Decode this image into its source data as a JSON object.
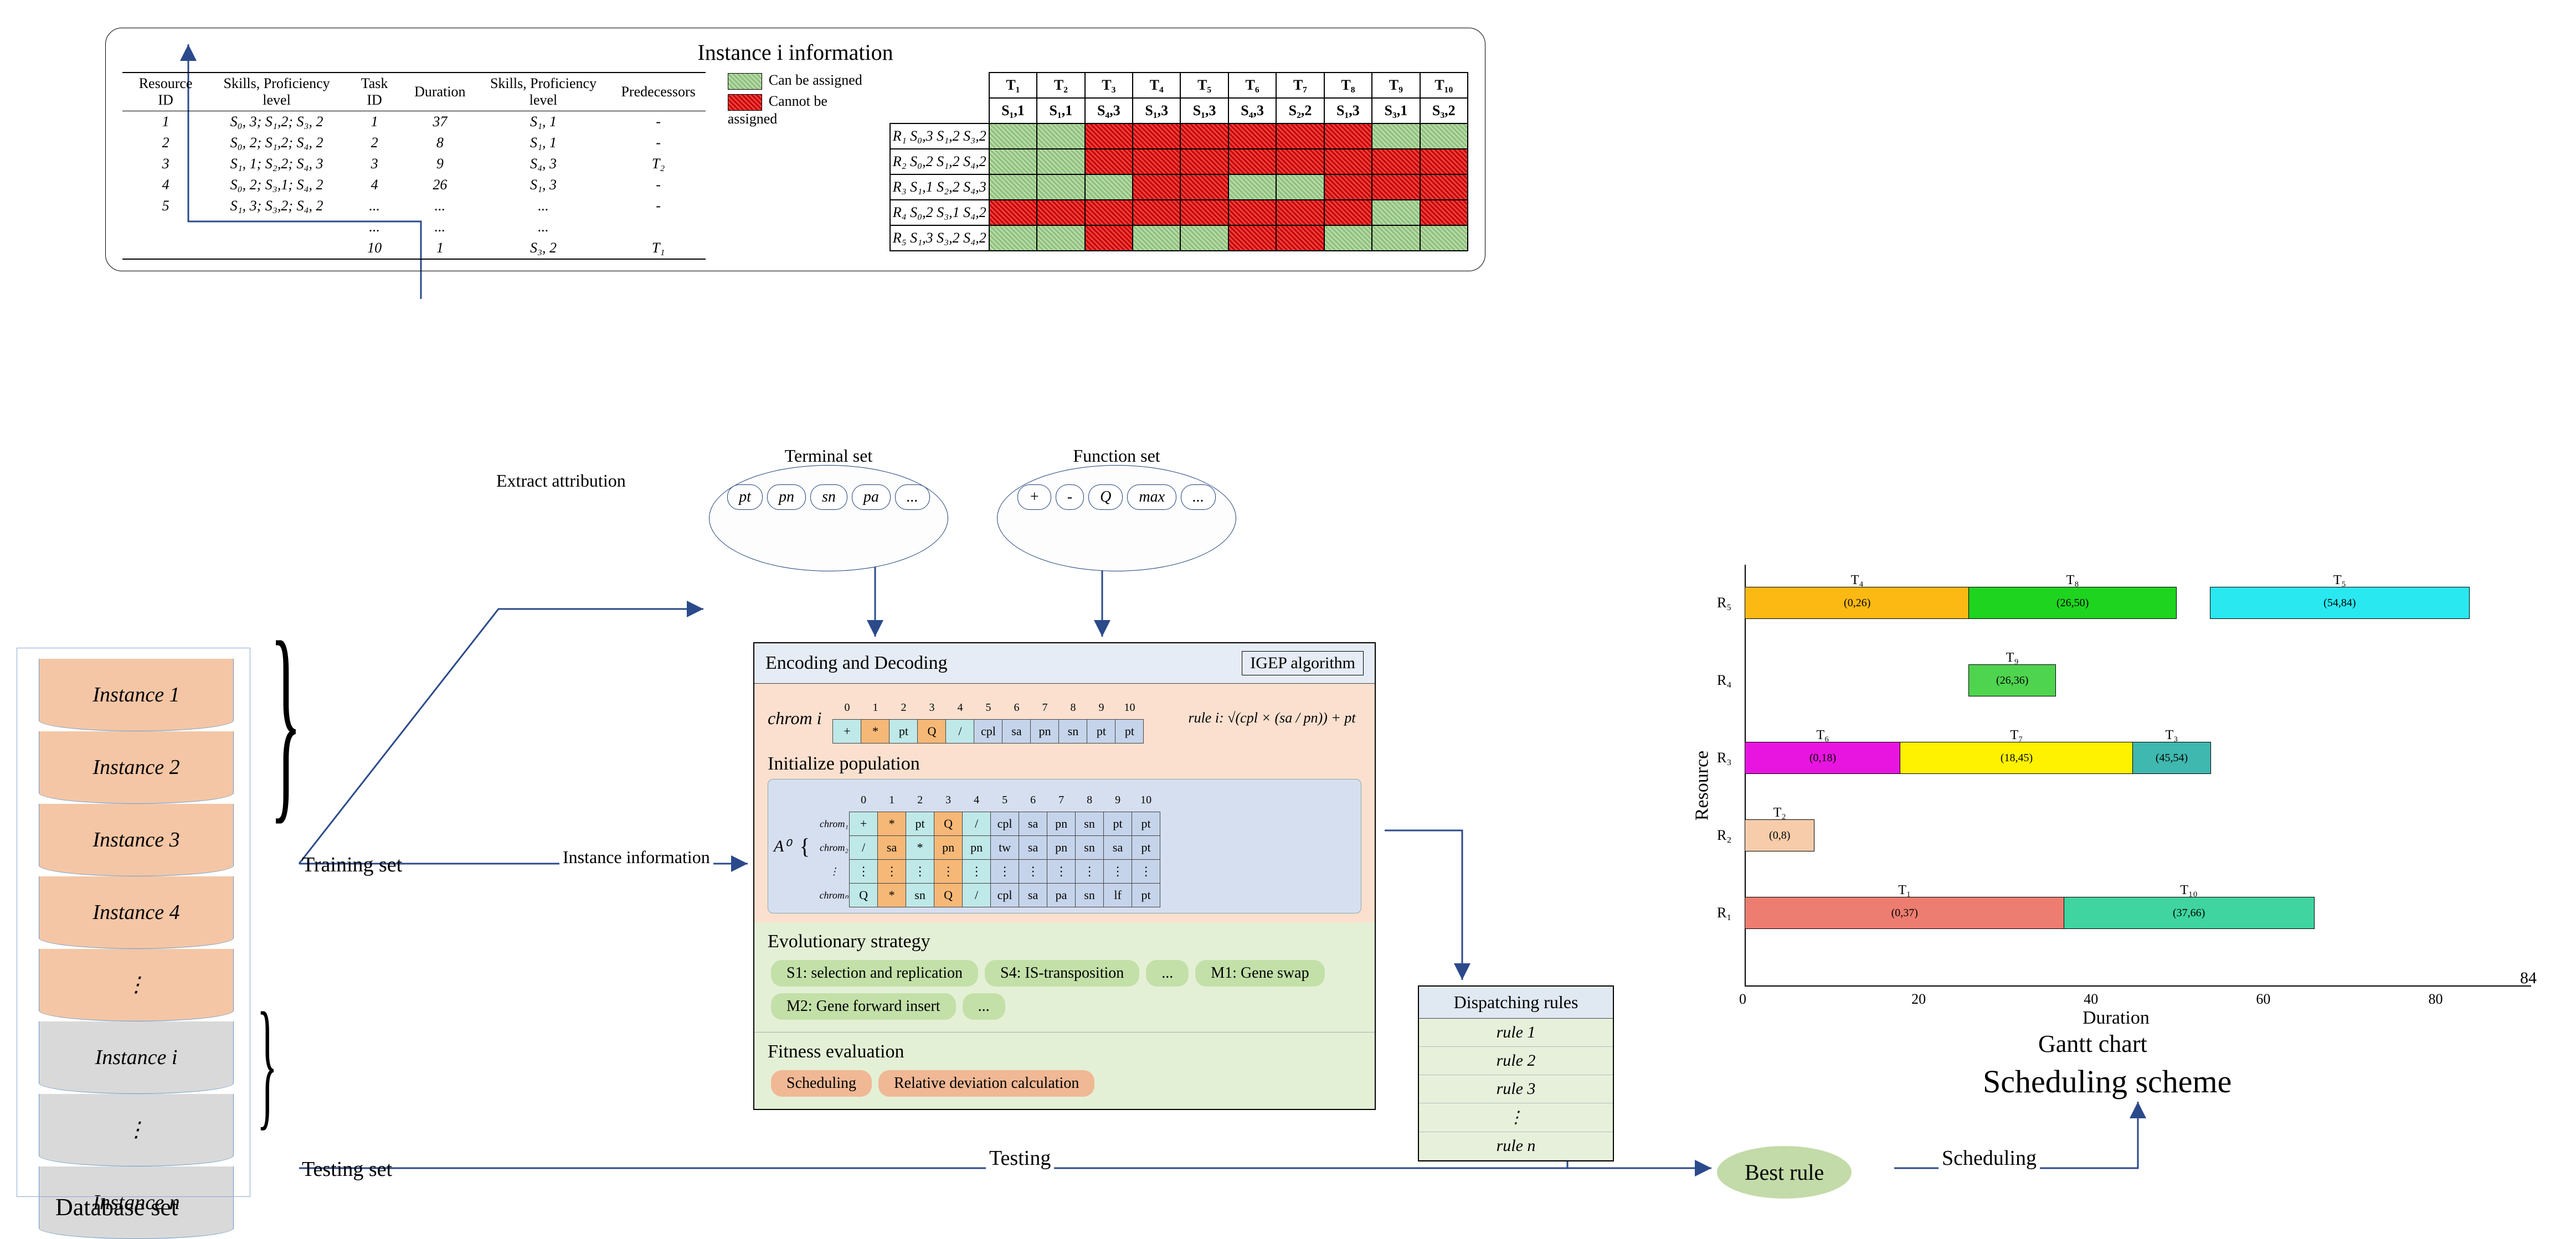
{
  "title": "Instance i information",
  "resource_table": {
    "headers": [
      "Resource ID",
      "Skills, Proficiency level",
      "Task ID",
      "Duration",
      "Skills, Proficiency level",
      "Predecessors"
    ],
    "rows": [
      [
        "1",
        "S₀, 3; S₁,2; S₃, 2",
        "1",
        "37",
        "S₁, 1",
        "-"
      ],
      [
        "2",
        "S₀, 2; S₁,2; S₄, 2",
        "2",
        "8",
        "S₁, 1",
        "-"
      ],
      [
        "3",
        "S₁, 1; S₂,2; S₄, 3",
        "3",
        "9",
        "S₄, 3",
        "T₂"
      ],
      [
        "4",
        "S₀, 2; S₃,1; S₄, 2",
        "4",
        "26",
        "S₁, 3",
        "-"
      ],
      [
        "5",
        "S₁, 3; S₃,2; S₄, 2",
        "...",
        "...",
        "...",
        "-"
      ],
      [
        "",
        "",
        "...",
        "...",
        "...",
        ""
      ],
      [
        "",
        "",
        "10",
        "1",
        "S₃, 2",
        "T₁"
      ]
    ]
  },
  "legend": {
    "can": "Can be assigned",
    "cannot": "Cannot be assigned"
  },
  "assign": {
    "tasks": [
      "T₁",
      "T₂",
      "T₃",
      "T₄",
      "T₅",
      "T₆",
      "T₇",
      "T₈",
      "T₉",
      "T₁₀"
    ],
    "skills": [
      "S₁,1",
      "S₁,1",
      "S₄,3",
      "S₁,3",
      "S₁,3",
      "S₄,3",
      "S₂,2",
      "S₁,3",
      "S₃,1",
      "S₃,2"
    ],
    "rows": [
      {
        "r": "R₁",
        "sk": "S₀,3 S₁,2 S₃,2",
        "cells": [
          "g",
          "g",
          "r",
          "r",
          "r",
          "r",
          "r",
          "r",
          "g",
          "g"
        ]
      },
      {
        "r": "R₂",
        "sk": "S₀,2 S₁,2 S₄,2",
        "cells": [
          "g",
          "g",
          "r",
          "r",
          "r",
          "r",
          "r",
          "r",
          "r",
          "r"
        ]
      },
      {
        "r": "R₃",
        "sk": "S₁,1 S₂,2 S₄,3",
        "cells": [
          "g",
          "g",
          "g",
          "r",
          "r",
          "g",
          "g",
          "r",
          "r",
          "r"
        ]
      },
      {
        "r": "R₄",
        "sk": "S₀,2 S₃,1 S₄,2",
        "cells": [
          "r",
          "r",
          "r",
          "r",
          "r",
          "r",
          "r",
          "r",
          "g",
          "r"
        ]
      },
      {
        "r": "R₅",
        "sk": "S₁,3 S₃,2 S₄,2",
        "cells": [
          "g",
          "g",
          "r",
          "g",
          "g",
          "r",
          "r",
          "g",
          "g",
          "g"
        ]
      }
    ]
  },
  "database": {
    "label": "Database set",
    "training": [
      "Instance 1",
      "Instance 2",
      "Instance 3",
      "Instance 4",
      "⋮"
    ],
    "testing": [
      "Instance i",
      "⋮",
      "Instance n"
    ]
  },
  "sets": {
    "train": "Training set",
    "test": "Testing set"
  },
  "terminal": {
    "title": "Terminal set",
    "items": [
      "pt",
      "pn",
      "sn",
      "pa",
      "..."
    ]
  },
  "function": {
    "title": "Function set",
    "items": [
      "+",
      "-",
      "Q",
      "max",
      "..."
    ]
  },
  "labels": {
    "extract": "Extract attribution",
    "instinfo": "Instance information",
    "testing": "Testing",
    "scheduling": "Scheduling"
  },
  "algo": {
    "header": "Encoding and Decoding",
    "tag": "IGEP algorithm",
    "chrom_label": "chrom i",
    "chrom_idx": [
      "0",
      "1",
      "2",
      "3",
      "4",
      "5",
      "6",
      "7",
      "8",
      "9",
      "10"
    ],
    "chrom_vals": [
      "+",
      "*",
      "pt",
      "Q",
      "/",
      "cpl",
      "sa",
      "pn",
      "sn",
      "pt",
      "pt"
    ],
    "rule": "rule i:  √(cpl × (sa / pn)) + pt",
    "init": "Initialize population",
    "init_label": "A⁰",
    "init_rows": [
      {
        "lab": "chrom₁",
        "v": [
          "+",
          "*",
          "pt",
          "Q",
          "/",
          "cpl",
          "sa",
          "pn",
          "sn",
          "pt",
          "pt"
        ]
      },
      {
        "lab": "chrom₂",
        "v": [
          "/",
          "sa",
          "*",
          "pn",
          "pn",
          "tw",
          "sa",
          "pn",
          "sn",
          "sa",
          "pt"
        ]
      },
      {
        "lab": "⋮",
        "v": [
          "⋮",
          "⋮",
          "⋮",
          "⋮",
          "⋮",
          "⋮",
          "⋮",
          "⋮",
          "⋮",
          "⋮",
          "⋮"
        ]
      },
      {
        "lab": "chromₙ",
        "v": [
          "Q",
          "*",
          "sn",
          "Q",
          "/",
          "cpl",
          "sa",
          "pa",
          "sn",
          "lf",
          "pt"
        ]
      }
    ],
    "evo": "Evolutionary strategy",
    "evo_items": [
      "S1: selection and replication",
      "S4: IS-transposition",
      "...",
      "M1: Gene swap",
      "M2: Gene forward insert",
      "..."
    ],
    "fit": "Fitness evaluation",
    "fit_items": [
      "Scheduling",
      "Relative deviation calculation"
    ]
  },
  "dispatch": {
    "title": "Dispatching rules",
    "rows": [
      "rule 1",
      "rule 2",
      "rule 3",
      "⋮",
      "rule n"
    ]
  },
  "best": "Best rule",
  "chart_data": {
    "type": "gantt",
    "title": "Gantt chart",
    "subtitle": "Scheduling scheme",
    "xlabel": "Duration",
    "ylabel": "Resource",
    "xlim": [
      0,
      90
    ],
    "makespan": 84,
    "resources": [
      "R₁",
      "R₂",
      "R₃",
      "R₄",
      "R₅"
    ],
    "bars": [
      {
        "res": "R₁",
        "task": "T₁",
        "start": 0,
        "end": 37,
        "color": "#ed7d70"
      },
      {
        "res": "R₁",
        "task": "T₁₀",
        "start": 37,
        "end": 66,
        "color": "#3fd4a0"
      },
      {
        "res": "R₂",
        "task": "T₂",
        "start": 0,
        "end": 8,
        "color": "#f6ccab"
      },
      {
        "res": "R₃",
        "task": "T₆",
        "start": 0,
        "end": 18,
        "color": "#e815e0"
      },
      {
        "res": "R₃",
        "task": "T₇",
        "start": 18,
        "end": 45,
        "color": "#fff200"
      },
      {
        "res": "R₃",
        "task": "T₃",
        "start": 45,
        "end": 54,
        "color": "#3fb8af"
      },
      {
        "res": "R₄",
        "task": "T₉",
        "start": 26,
        "end": 36,
        "color": "#4fd44f"
      },
      {
        "res": "R₅",
        "task": "T₄",
        "start": 0,
        "end": 26,
        "color": "#fdb913"
      },
      {
        "res": "R₅",
        "task": "T₈",
        "start": 26,
        "end": 50,
        "color": "#1fd41f"
      },
      {
        "res": "R₅",
        "task": "T₅",
        "start": 54,
        "end": 84,
        "color": "#29e8f0"
      }
    ],
    "xticks": [
      0,
      20,
      40,
      60,
      80
    ]
  }
}
